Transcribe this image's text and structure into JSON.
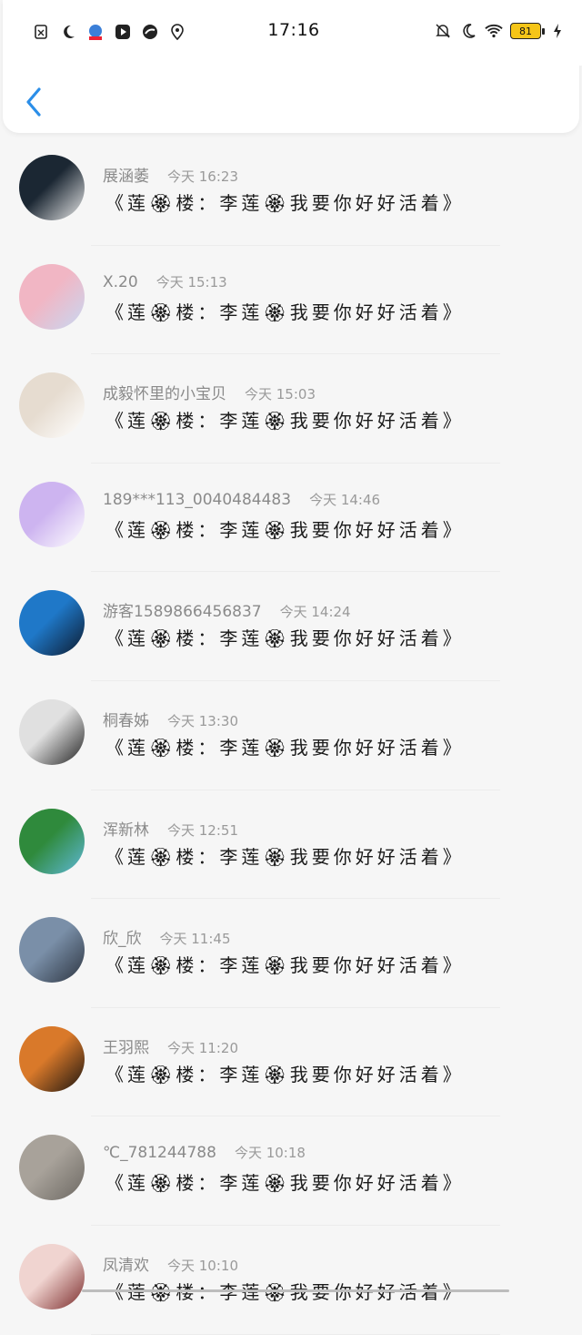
{
  "status": {
    "time": "17:16",
    "battery": "81"
  },
  "comments": [
    {
      "name": "展涵萎",
      "time": "今天 16:23",
      "text": "《莲🏵楼：李莲🏵我要你好好活着》",
      "avatar_colors": [
        "#1b2733",
        "#e8e8e8"
      ]
    },
    {
      "name": "X.20",
      "time": "今天 15:13",
      "text": "《莲🏵楼：李莲🏵我要你好好活着》",
      "avatar_colors": [
        "#f1b6c4",
        "#c7d8f2"
      ]
    },
    {
      "name": "成毅怀里的小宝贝",
      "time": "今天 15:03",
      "text": "《莲🏵楼：李莲🏵我要你好好活着》",
      "avatar_colors": [
        "#e6dcd0",
        "#ffffff"
      ]
    },
    {
      "name": "189***113_0040484483",
      "time": "今天 14:46",
      "text": "《莲🏵楼：李莲🏵我要你好好活着》",
      "avatar_colors": [
        "#cdb4f0",
        "#ffffff"
      ]
    },
    {
      "name": "游客1589866456837",
      "time": "今天 14:24",
      "text": "《莲🏵楼：李莲🏵我要你好好活着》",
      "avatar_colors": [
        "#1f78c8",
        "#0d1a2e"
      ]
    },
    {
      "name": "桐春姊",
      "time": "今天 13:30",
      "text": "《莲🏵楼：李莲🏵我要你好好活着》",
      "avatar_colors": [
        "#e0e0e0",
        "#222222"
      ]
    },
    {
      "name": "浑新林",
      "time": "今天 12:51",
      "text": "《莲🏵楼：李莲🏵我要你好好活着》",
      "avatar_colors": [
        "#2f8a3c",
        "#5fb8d8"
      ]
    },
    {
      "name": "欣_欣",
      "time": "今天 11:45",
      "text": "《莲🏵楼：李莲🏵我要你好好活着》",
      "avatar_colors": [
        "#7a8fa8",
        "#2c3440"
      ]
    },
    {
      "name": "王羽熙",
      "time": "今天 11:20",
      "text": "《莲🏵楼：李莲🏵我要你好好活着》",
      "avatar_colors": [
        "#d9792a",
        "#1a1410"
      ]
    },
    {
      "name": "℃_781244788",
      "time": "今天 10:18",
      "text": "《莲🏵楼：李莲🏵我要你好好活着》",
      "avatar_colors": [
        "#a8a29a",
        "#6c6862"
      ]
    },
    {
      "name": "凤清欢",
      "time": "今天 10:10",
      "text": "《莲🏵楼：李莲🏵我要你好好活着》",
      "avatar_colors": [
        "#f0d4d0",
        "#7a2a2a"
      ]
    }
  ]
}
